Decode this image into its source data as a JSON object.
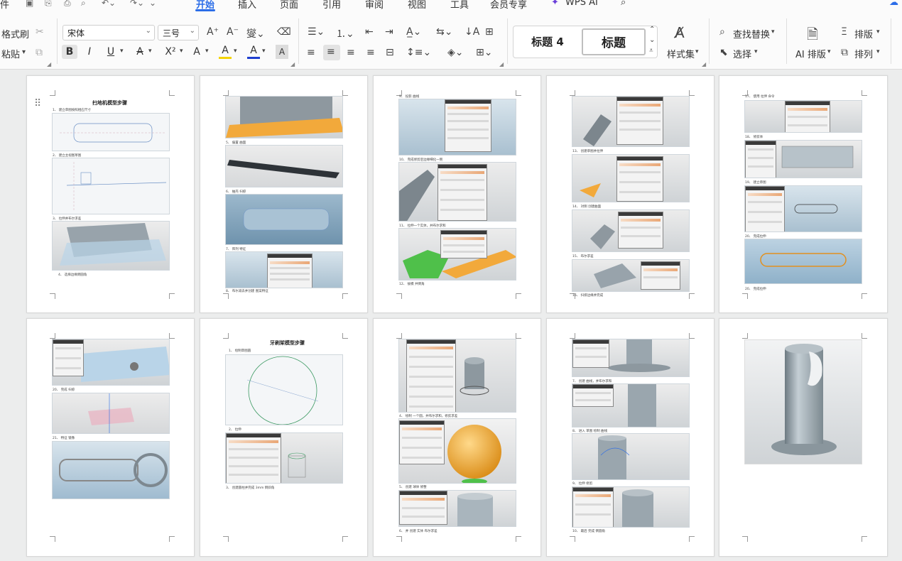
{
  "tabs": {
    "file_partial": "件",
    "items": [
      "开始",
      "插入",
      "页面",
      "引用",
      "审阅",
      "视图",
      "工具",
      "会员专享",
      "WPS AI"
    ],
    "active": "开始"
  },
  "ribbon": {
    "format_painter": "格式刷",
    "paste": "粘贴",
    "font_name": "宋体",
    "font_size": "三号",
    "bold": "B",
    "italic": "I",
    "underline": "U",
    "strike": "A",
    "superscript": "X²",
    "text_effect": "A",
    "highlight": "A",
    "font_color": "A",
    "char_shading": "A",
    "styles": [
      "标题 4",
      "标题"
    ],
    "styles_gallery": "样式集",
    "find_replace": "查找替换",
    "select": "选择",
    "ai_layout": "AI 排版",
    "layout": "排版",
    "arrange": "排列",
    "colors": {
      "accent": "#2b6de8",
      "highlight_bar": "#f5d400",
      "font_color_bar": "#1f3fd0"
    }
  },
  "pages": [
    {
      "title": "扫地机模型步骤",
      "captions": [
        "1、 建立草图按照相应尺寸",
        "2、 建立主视图草图",
        "3、 拉伸并布尔求差",
        "4、 选择边缘倒圆角"
      ]
    },
    {
      "captions": [
        "5、 偏置 曲面",
        "6、 抽壳 扫掠",
        "7、 阵列 特征",
        "8、 布尔减去并创建 图案特征"
      ]
    },
    {
      "captions": [
        "9、 投影 曲线",
        "10、 完成修剪后边缘细化一侧",
        "11、 拉伸一个实体，并布尔求和",
        "12、 拔模 并倒角"
      ]
    },
    {
      "captions": [
        "13、 创建草图并拉伸",
        "14、 对侧 创建曲面",
        "15、 布尔求差",
        "16、 扫掠边缘并完成"
      ]
    },
    {
      "captions": [
        "17、 使用 拉伸 命令",
        "18、 修剪体",
        "19、 建立草图",
        "20、 完成拉伸"
      ]
    },
    {
      "captions": [
        "20、 完成 扫掠",
        "21、 特征 镜像"
      ]
    },
    {
      "title": "牙刷架模型步骤",
      "captions": [
        "1、 绘制草图圆",
        "2、 拉伸",
        "3、 创建圆柱并完成 3mm 倒斜角"
      ]
    },
    {
      "captions": [
        "4、 绘制 一个圆，并布尔求和，修剪求差",
        "5、 创建 球体 修整",
        "6、 并 创建 实体 布尔求差"
      ]
    },
    {
      "captions": [
        "7、 创建 曲线，并布尔求和",
        "8、 进入 草图 绘制 曲线",
        "9、 拉伸 修剪",
        "10、 最后 完成 倒圆角"
      ]
    },
    {
      "captions": []
    }
  ]
}
